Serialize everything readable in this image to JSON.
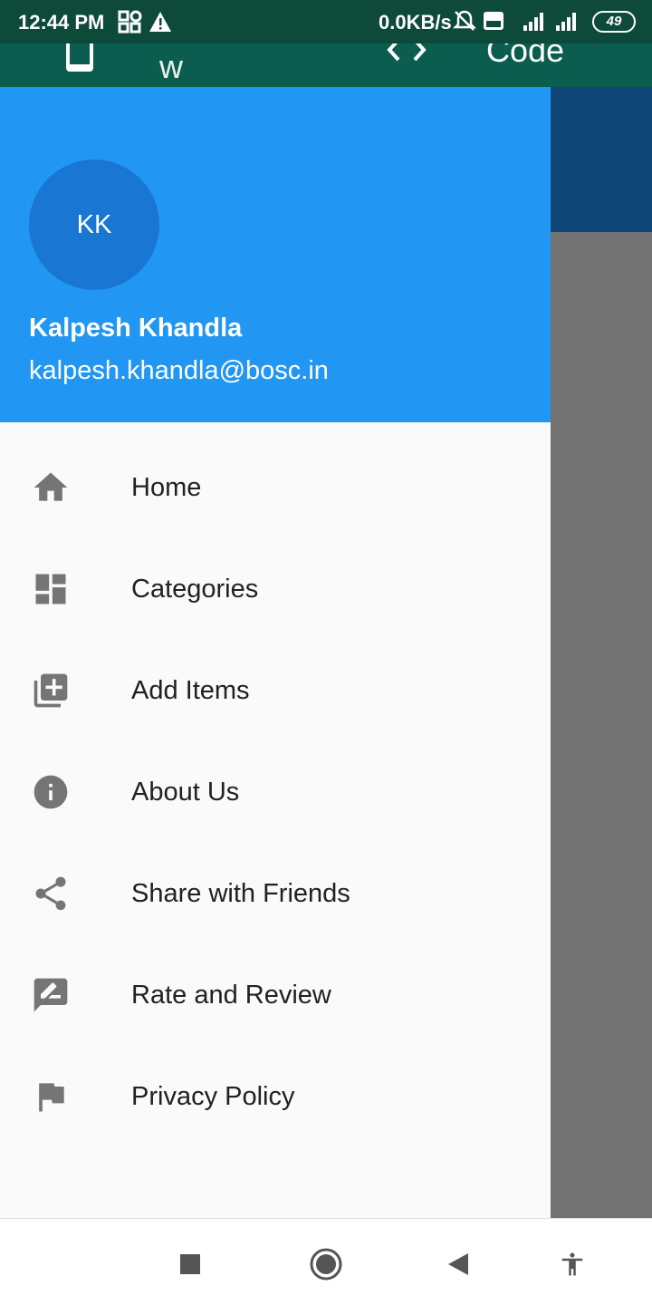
{
  "status_bar": {
    "time": "12:44 PM",
    "net_speed": "0.0KB/s",
    "battery": "49",
    "icons": [
      "grid-icon",
      "warning-icon",
      "mute-bell-icon",
      "volte-icon",
      "signal-4g-icon",
      "signal-icon",
      "battery-icon"
    ]
  },
  "app_bar": {
    "preview_label": "Preview",
    "code_label": "Code"
  },
  "drawer": {
    "avatar_initials": "KK",
    "account_name": "Kalpesh Khandla",
    "account_email": "kalpesh.khandla@bosc.in",
    "items": [
      {
        "label": "Home",
        "icon": "home-icon"
      },
      {
        "label": "Categories",
        "icon": "dashboard-icon"
      },
      {
        "label": "Add Items",
        "icon": "library-add-icon"
      },
      {
        "label": "About Us",
        "icon": "info-icon"
      },
      {
        "label": "Share with Friends",
        "icon": "share-icon"
      },
      {
        "label": "Rate and Review",
        "icon": "rate-review-icon"
      },
      {
        "label": "Privacy Policy",
        "icon": "flag-icon"
      }
    ]
  },
  "nav_bar": {
    "buttons": [
      "recents-icon",
      "home-circle-icon",
      "back-icon",
      "accessibility-icon"
    ]
  },
  "colors": {
    "header_blue": "#2196f3",
    "avatar_blue": "#1976d2",
    "app_bar_green": "#0b5d4f",
    "scrim": "#737373",
    "icon_grey": "#757575"
  }
}
